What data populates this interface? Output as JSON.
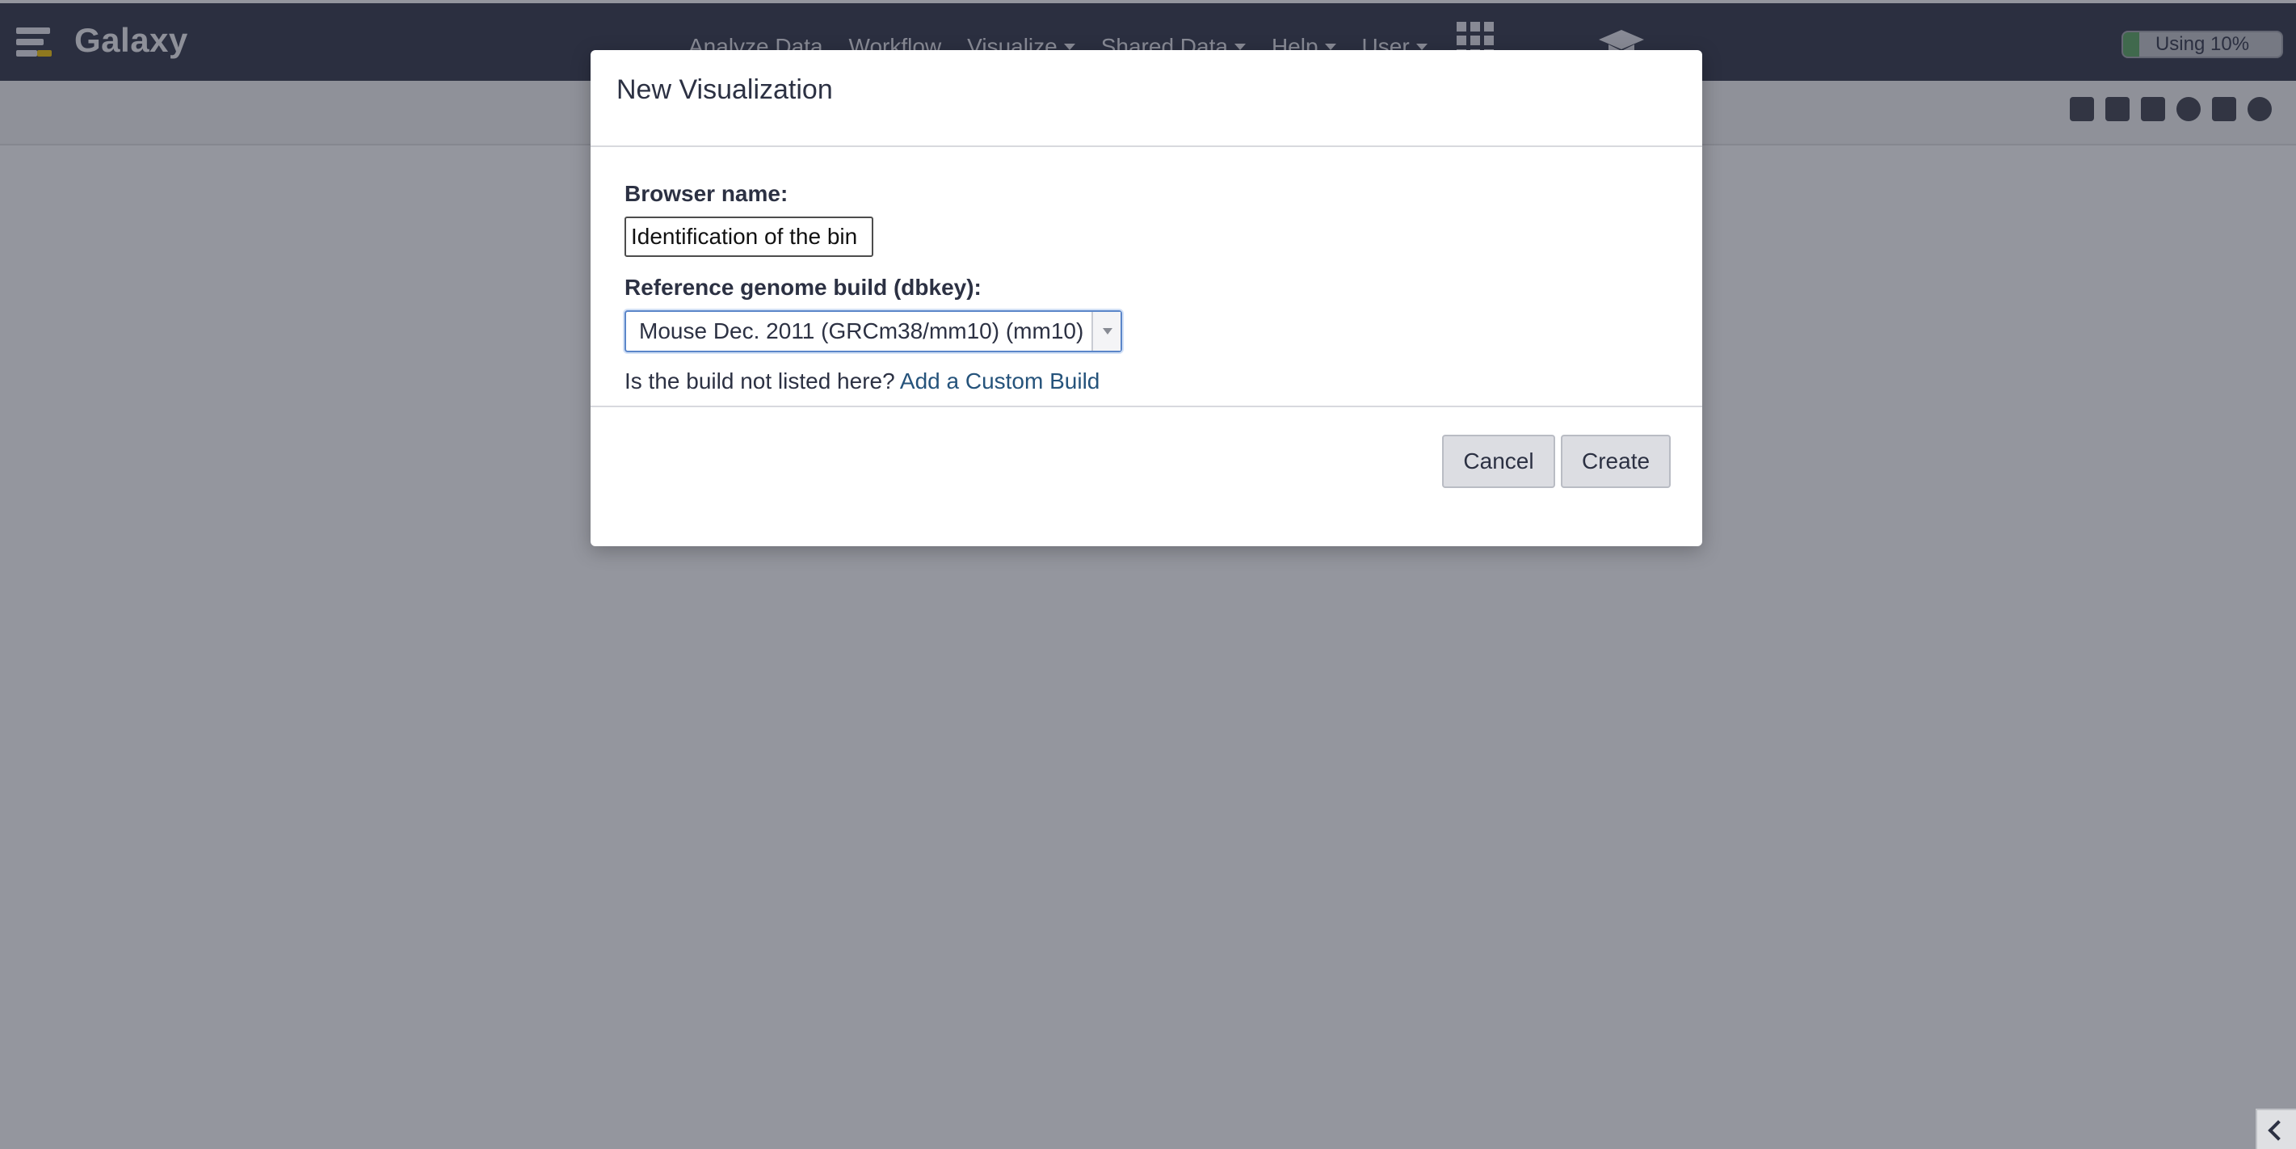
{
  "brand": {
    "title": "Galaxy"
  },
  "nav": {
    "items": [
      {
        "label": "Analyze Data",
        "dropdown": false
      },
      {
        "label": "Workflow",
        "dropdown": false
      },
      {
        "label": "Visualize",
        "dropdown": true
      },
      {
        "label": "Shared Data",
        "dropdown": true
      },
      {
        "label": "Help",
        "dropdown": true
      },
      {
        "label": "User",
        "dropdown": true
      }
    ],
    "apps_icon": "grid-icon",
    "tour_icon": "graduation-cap-icon"
  },
  "usage": {
    "label": "Using 10%",
    "percent": 10,
    "fill_color": "#56a45d"
  },
  "toolbar": {
    "icons": [
      "add-track-icon",
      "copy-icon",
      "bookmark-icon",
      "globe-icon",
      "save-icon",
      "close-icon"
    ]
  },
  "modal": {
    "title": "New Visualization",
    "browser_name_label": "Browser name:",
    "browser_name_value": "Identification of the bin",
    "genome_label": "Reference genome build (dbkey):",
    "genome_selected": "Mouse Dec. 2011 (GRCm38/mm10) (mm10)",
    "help_text": "Is the build not listed here?",
    "help_link": "Add a Custom Build",
    "cancel_label": "Cancel",
    "create_label": "Create"
  },
  "colors": {
    "masthead": "#2c3143",
    "link": "#25537b",
    "focus": "#5b86c9"
  }
}
